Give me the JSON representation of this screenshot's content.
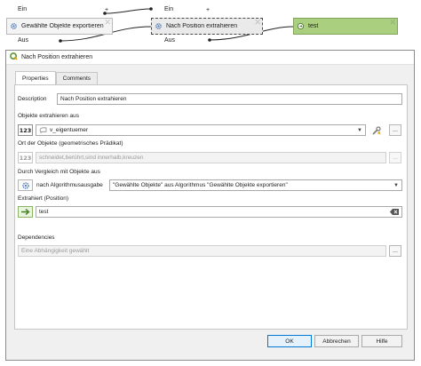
{
  "canvas": {
    "node_exported": {
      "label": "Gewählte Objekte exportieren",
      "close": "⤫"
    },
    "node_extract": {
      "label": "Nach Position extrahieren",
      "close": "⤫"
    },
    "node_output": {
      "label": "test",
      "close": "⤫"
    },
    "port_in_top": "Ein",
    "port_out_left": "Aus",
    "port_out_mid": "Aus",
    "plus": "+"
  },
  "dialog": {
    "title": "Nach Position extrahieren",
    "tabs": [
      {
        "label": "Properties",
        "active": true
      },
      {
        "label": "Comments",
        "active": false
      }
    ],
    "description": {
      "label": "Description",
      "value": "Nach Position extrahieren"
    },
    "extract_from": {
      "label": "Objekte extrahieren aus",
      "type_badge": "123",
      "value": "v_eigentuemer",
      "more_button": "..."
    },
    "predicate": {
      "label": "Ort der Objekte (geometrisches Prädikat)",
      "type_badge": "123",
      "value": "schneidet,berührt,sind innerhalb,kreuzen",
      "more_button": "..."
    },
    "compare": {
      "label": "Durch Vergleich mit Objekte aus",
      "source_text": "nach Algorithmusausgabe",
      "value": "\"Gewählte Objekte\" aus Algorithmus \"Gewählte Objekte exportieren\""
    },
    "extracted": {
      "label": "Extrahiert (Position)",
      "value": "test"
    },
    "dependencies": {
      "label": "Dependencies",
      "placeholder": "Eine Abhängigkeit gewählt",
      "more_button": "..."
    },
    "buttons": {
      "ok": "OK",
      "cancel": "Abbrechen",
      "help": "Hilfe"
    }
  },
  "colors": {
    "output_node": "#a9cf7f",
    "accent": "#0078d7"
  }
}
